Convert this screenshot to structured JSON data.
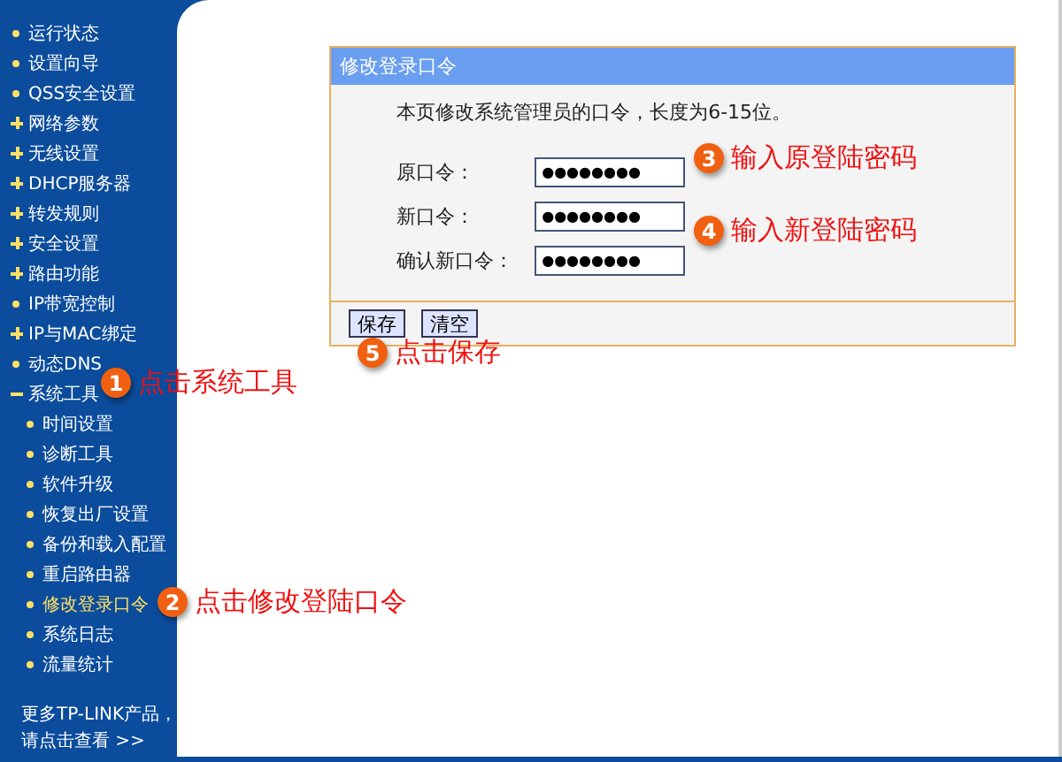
{
  "sidebar": {
    "items": [
      {
        "label": "运行状态",
        "kind": "leaf"
      },
      {
        "label": "设置向导",
        "kind": "leaf"
      },
      {
        "label": "QSS安全设置",
        "kind": "leaf"
      },
      {
        "label": "网络参数",
        "kind": "group",
        "expanded": false
      },
      {
        "label": "无线设置",
        "kind": "group",
        "expanded": false
      },
      {
        "label": "DHCP服务器",
        "kind": "group",
        "expanded": false
      },
      {
        "label": "转发规则",
        "kind": "group",
        "expanded": false
      },
      {
        "label": "安全设置",
        "kind": "group",
        "expanded": false
      },
      {
        "label": "路由功能",
        "kind": "group",
        "expanded": false
      },
      {
        "label": "IP带宽控制",
        "kind": "leaf"
      },
      {
        "label": "IP与MAC绑定",
        "kind": "group",
        "expanded": false
      },
      {
        "label": "动态DNS",
        "kind": "leaf"
      },
      {
        "label": "系统工具",
        "kind": "group",
        "expanded": true,
        "children": [
          {
            "label": "时间设置",
            "selected": false
          },
          {
            "label": "诊断工具",
            "selected": false
          },
          {
            "label": "软件升级",
            "selected": false
          },
          {
            "label": "恢复出厂设置",
            "selected": false
          },
          {
            "label": "备份和载入配置",
            "selected": false
          },
          {
            "label": "重启路由器",
            "selected": false
          },
          {
            "label": "修改登录口令",
            "selected": true
          },
          {
            "label": "系统日志",
            "selected": false
          },
          {
            "label": "流量统计",
            "selected": false
          }
        ]
      }
    ],
    "footer": [
      "更多TP-LINK产品，",
      "请点击查看 >>"
    ]
  },
  "panel": {
    "title": "修改登录口令",
    "description": "本页修改系统管理员的口令，长度为6-15位。",
    "fields": [
      {
        "label": "原口令：",
        "value": "●●●●●●●●"
      },
      {
        "label": "新口令：",
        "value": "●●●●●●●●"
      },
      {
        "label": "确认新口令：",
        "value": "●●●●●●●●"
      }
    ],
    "buttons": [
      "保存",
      "清空"
    ]
  },
  "annotations": [
    {
      "number": "1",
      "text": "点击系统工具"
    },
    {
      "number": "2",
      "text": "点击修改登陆口令"
    },
    {
      "number": "3",
      "text": "输入原登陆密码"
    },
    {
      "number": "4",
      "text": "输入新登陆密码"
    },
    {
      "number": "5",
      "text": "点击保存"
    }
  ]
}
